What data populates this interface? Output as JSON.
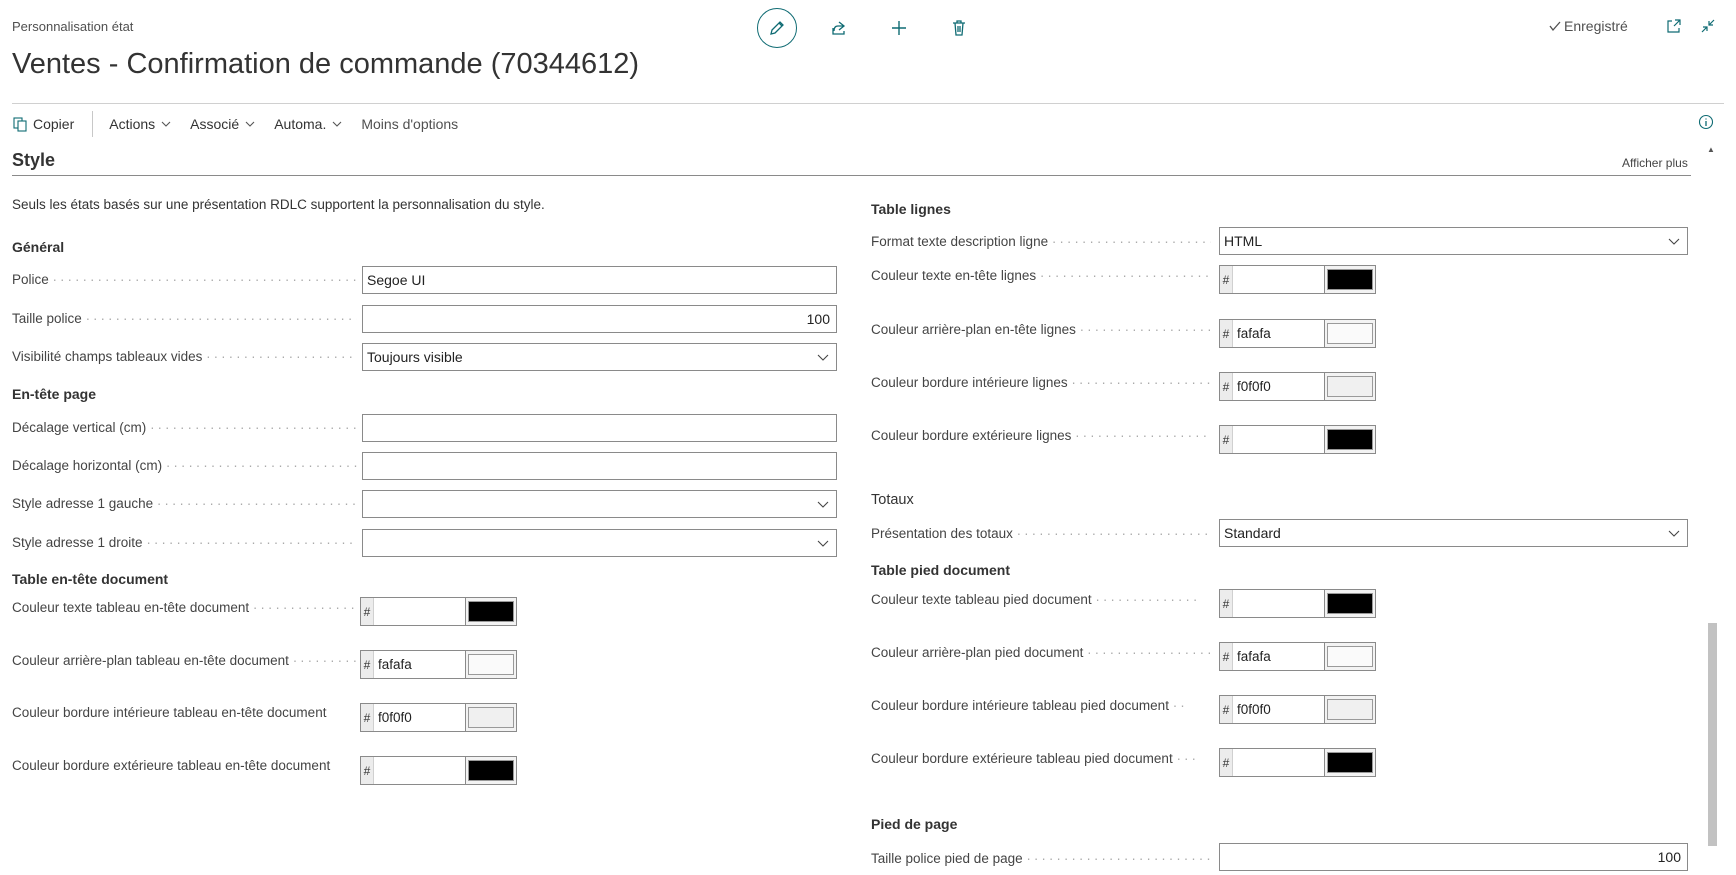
{
  "header": {
    "breadcrumb": "Personnalisation état",
    "title": "Ventes - Confirmation de commande (70344612)",
    "saved_label": "Enregistré"
  },
  "toolbar": {
    "copy_label": "Copier",
    "actions_label": "Actions",
    "related_label": "Associé",
    "automate_label": "Automa.",
    "fewer_options_label": "Moins d'options"
  },
  "section": {
    "title": "Style",
    "show_more": "Afficher plus",
    "note": "Seuls les états basés sur une présentation RDLC supportent la personnalisation du style."
  },
  "left": {
    "general": {
      "heading": "Général",
      "police_label": "Police",
      "police_value": "Segoe UI",
      "taille_label": "Taille police",
      "taille_value": "100",
      "visibilite_label": "Visibilité champs tableaux vides",
      "visibilite_value": "Toujours visible"
    },
    "page_header": {
      "heading": "En-tête page",
      "vertical_label": "Décalage vertical (cm)",
      "vertical_value": "",
      "horizontal_label": "Décalage horizontal (cm)",
      "horizontal_value": "",
      "addr_left_label": "Style adresse 1 gauche",
      "addr_left_value": "",
      "addr_right_label": "Style adresse 1 droite",
      "addr_right_value": ""
    },
    "doc_header_table": {
      "heading": "Table en-tête document",
      "text_color_label": "Couleur texte tableau en-tête document",
      "text_color_value": "",
      "text_color_swatch": "#000000",
      "bg_color_label": "Couleur arrière-plan tableau en-tête document",
      "bg_color_value": "fafafa",
      "bg_color_swatch": "#fafafa",
      "inner_border_label": "Couleur bordure intérieure tableau en-tête document",
      "inner_border_value": "f0f0f0",
      "inner_border_swatch": "#f0f0f0",
      "outer_border_label": "Couleur bordure extérieure tableau en-tête document",
      "outer_border_value": "",
      "outer_border_swatch": "#000000"
    }
  },
  "right": {
    "lines_table": {
      "heading": "Table lignes",
      "desc_format_label": "Format texte description ligne",
      "desc_format_value": "HTML",
      "header_text_label": "Couleur texte en-tête lignes",
      "header_text_value": "",
      "header_text_swatch": "#000000",
      "header_bg_label": "Couleur arrière-plan en-tête lignes",
      "header_bg_value": "fafafa",
      "header_bg_swatch": "#fafafa",
      "inner_border_label": "Couleur bordure intérieure lignes",
      "inner_border_value": "f0f0f0",
      "inner_border_swatch": "#f0f0f0",
      "outer_border_label": "Couleur bordure extérieure lignes",
      "outer_border_value": "",
      "outer_border_swatch": "#000000"
    },
    "totals": {
      "heading": "Totaux",
      "presentation_label": "Présentation des totaux",
      "presentation_value": "Standard"
    },
    "doc_footer_table": {
      "heading": "Table pied document",
      "text_color_label": "Couleur texte tableau pied document",
      "text_color_value": "",
      "text_color_swatch": "#000000",
      "bg_color_label": "Couleur arrière-plan pied document",
      "bg_color_value": "fafafa",
      "bg_color_swatch": "#fafafa",
      "inner_border_label": "Couleur bordure intérieure tableau pied document",
      "inner_border_value": "f0f0f0",
      "inner_border_swatch": "#f0f0f0",
      "outer_border_label": "Couleur bordure extérieure tableau pied document",
      "outer_border_value": "",
      "outer_border_swatch": "#000000"
    },
    "page_footer": {
      "heading": "Pied de page",
      "font_size_label": "Taille police pied de page",
      "font_size_value": "100"
    }
  },
  "colors": {
    "accent": "#0f6b73",
    "border": "#8a8a8a",
    "text": "#212121"
  }
}
